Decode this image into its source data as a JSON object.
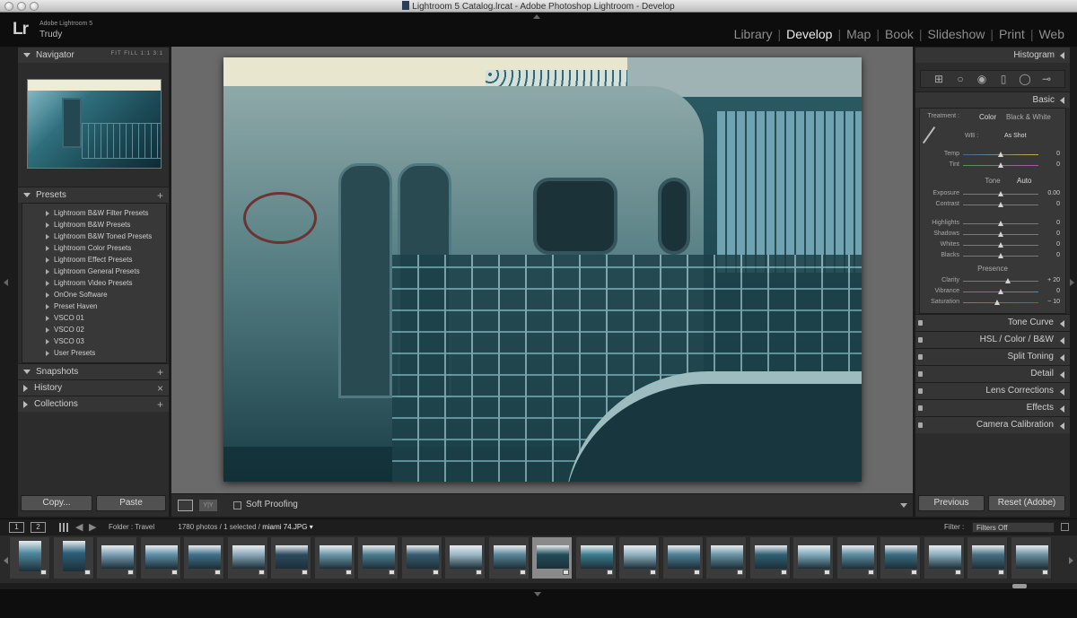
{
  "window": {
    "title": "Lightroom 5 Catalog.lrcat - Adobe Photoshop Lightroom - Develop"
  },
  "identity": {
    "logo": "Lr",
    "app_name": "Adobe Lightroom 5",
    "user": "Trudy"
  },
  "modules": [
    "Library",
    "Develop",
    "Map",
    "Book",
    "Slideshow",
    "Print",
    "Web"
  ],
  "active_module": "Develop",
  "left_panel": {
    "navigator": {
      "title": "Navigator",
      "options": "FIT  FILL  1:1  3:1"
    },
    "presets": {
      "title": "Presets",
      "items": [
        "Lightroom B&W Filter Presets",
        "Lightroom B&W Presets",
        "Lightroom B&W Toned Presets",
        "Lightroom Color Presets",
        "Lightroom Effect Presets",
        "Lightroom General Presets",
        "Lightroom Video Presets",
        "OnOne Software",
        "Preset Haven",
        "VSCO 01",
        "VSCO 02",
        "VSCO 03",
        "User Presets"
      ]
    },
    "snapshots": "Snapshots",
    "history": "History",
    "history_close": "×",
    "collections": "Collections",
    "copy_button": "Copy...",
    "paste_button": "Paste"
  },
  "toolbar": {
    "soft_proofing": "Soft Proofing",
    "before_after_icon": "Y|Y"
  },
  "right_panel": {
    "histogram": "Histogram",
    "basic": {
      "title": "Basic",
      "treatment_label": "Treatment :",
      "treatment_options": [
        "Color",
        "Black & White"
      ],
      "wb_label": "WB :",
      "wb_value": "As Shot",
      "tone_label": "Tone",
      "auto_button": "Auto",
      "presence_label": "Presence",
      "sliders": [
        {
          "label": "Temp",
          "value": "0",
          "position": 0.5
        },
        {
          "label": "Tint",
          "value": "0",
          "position": 0.5
        },
        {
          "label": "Exposure",
          "value": "0.00",
          "position": 0.5
        },
        {
          "label": "Contrast",
          "value": "0",
          "position": 0.5
        },
        {
          "label": "Highlights",
          "value": "0",
          "position": 0.5
        },
        {
          "label": "Shadows",
          "value": "0",
          "position": 0.5
        },
        {
          "label": "Whites",
          "value": "0",
          "position": 0.5
        },
        {
          "label": "Blacks",
          "value": "0",
          "position": 0.5
        },
        {
          "label": "Clarity",
          "value": "+ 20",
          "position": 0.6
        },
        {
          "label": "Vibrance",
          "value": "0",
          "position": 0.5
        },
        {
          "label": "Saturation",
          "value": "− 10",
          "position": 0.45
        }
      ]
    },
    "sections": [
      "Tone Curve",
      "HSL / Color / B&W",
      "Split Toning",
      "Detail",
      "Lens Corrections",
      "Effects",
      "Camera Calibration"
    ],
    "previous_button": "Previous",
    "reset_button": "Reset (Adobe)"
  },
  "filmstrip": {
    "screen1": "1",
    "screen2": "2",
    "source": "Folder : Travel",
    "count": "1780 photos / 1 selected /",
    "filename": "miami 74.JPG",
    "filter_label": "Filter :",
    "filter_value": "Filters Off",
    "selected_index": 12
  },
  "colors": {
    "panel": "#2c2c2c",
    "background": "#6a6a6a",
    "accent_active": "#ececec"
  }
}
